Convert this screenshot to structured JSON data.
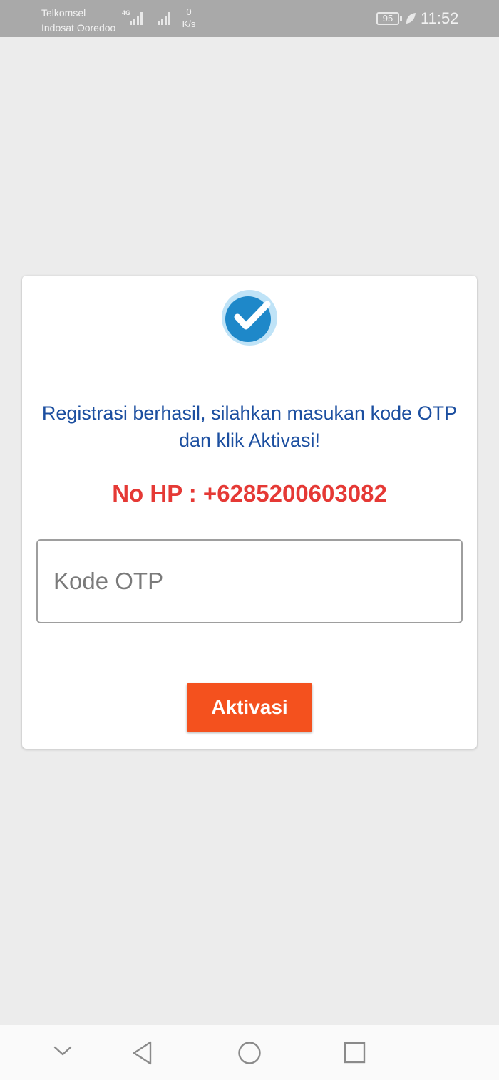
{
  "status_bar": {
    "carrier_1": "Telkomsel",
    "carrier_2": "Indosat Ooredoo",
    "network_type": "4G",
    "speed_value": "0",
    "speed_unit": "K/s",
    "battery": "95",
    "time": "11:52"
  },
  "dialog": {
    "icon": "check-circle-icon",
    "message": "Registrasi berhasil, silahkan masukan kode OTP dan klik Aktivasi!",
    "phone": "No HP : +6285200603082",
    "otp_input": {
      "value": "",
      "placeholder": "Kode OTP"
    },
    "submit_label": "Aktivasi"
  },
  "nav_bar": {
    "buttons": [
      "chevron-down-icon",
      "back-icon",
      "home-icon",
      "recents-icon"
    ]
  },
  "colors": {
    "message_text": "#1c4fa0",
    "phone_text": "#e53935",
    "button": "#f4511e",
    "status_bar": "#a9a9a9",
    "background": "#ececec"
  }
}
